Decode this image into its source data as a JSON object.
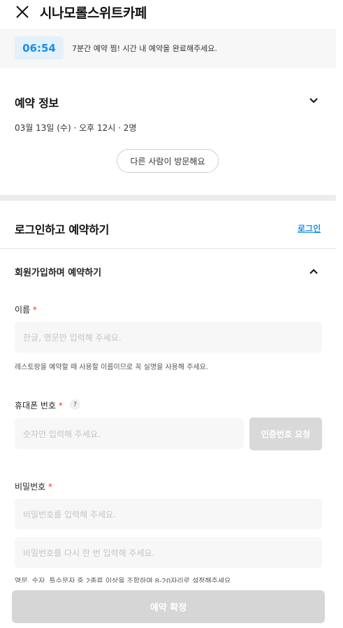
{
  "header": {
    "title": "시나모롤스위트카페",
    "close_icon": "close-icon"
  },
  "timer": {
    "time": "06:54",
    "message": "7분간 예약 찜! 시간 내 예약을 완료해주세요.",
    "accent": "#1a8ee6"
  },
  "booking_info": {
    "title": "예약 정보",
    "summary": "03월 13일 (수) · 오후 12시 · 2명",
    "other_visitor_button": "다른 사람이 방문해요",
    "toggle_icon": "chevron-down-icon"
  },
  "login_section": {
    "title": "로그인하고 예약하기",
    "login_link": "로그인"
  },
  "signup": {
    "title": "회원가입하며 예약하기",
    "toggle_icon": "chevron-up-icon",
    "name": {
      "label": "이름",
      "required_mark": "*",
      "placeholder": "한글, 영문만 입력해 주세요.",
      "help": "레스토랑을 예약할 때 사용할 이름이므로 꼭 실명을 사용해 주세요."
    },
    "phone": {
      "label": "휴대폰 번호",
      "required_mark": "*",
      "help_icon": "?",
      "placeholder": "숫자만 입력해 주세요.",
      "verify_button": "인증번호 요청"
    },
    "password": {
      "label": "비밀번호",
      "required_mark": "*",
      "placeholder": "비밀번호를 입력해 주세요.",
      "confirm_placeholder": "비밀번호를 다시 한 번 입력해 주세요.",
      "help": "영문, 숫자, 특수문자 중 2종류 이상을 조합하여 8-20자리로 설정해주세요."
    }
  },
  "footer": {
    "confirm_button": "예약 확정"
  }
}
